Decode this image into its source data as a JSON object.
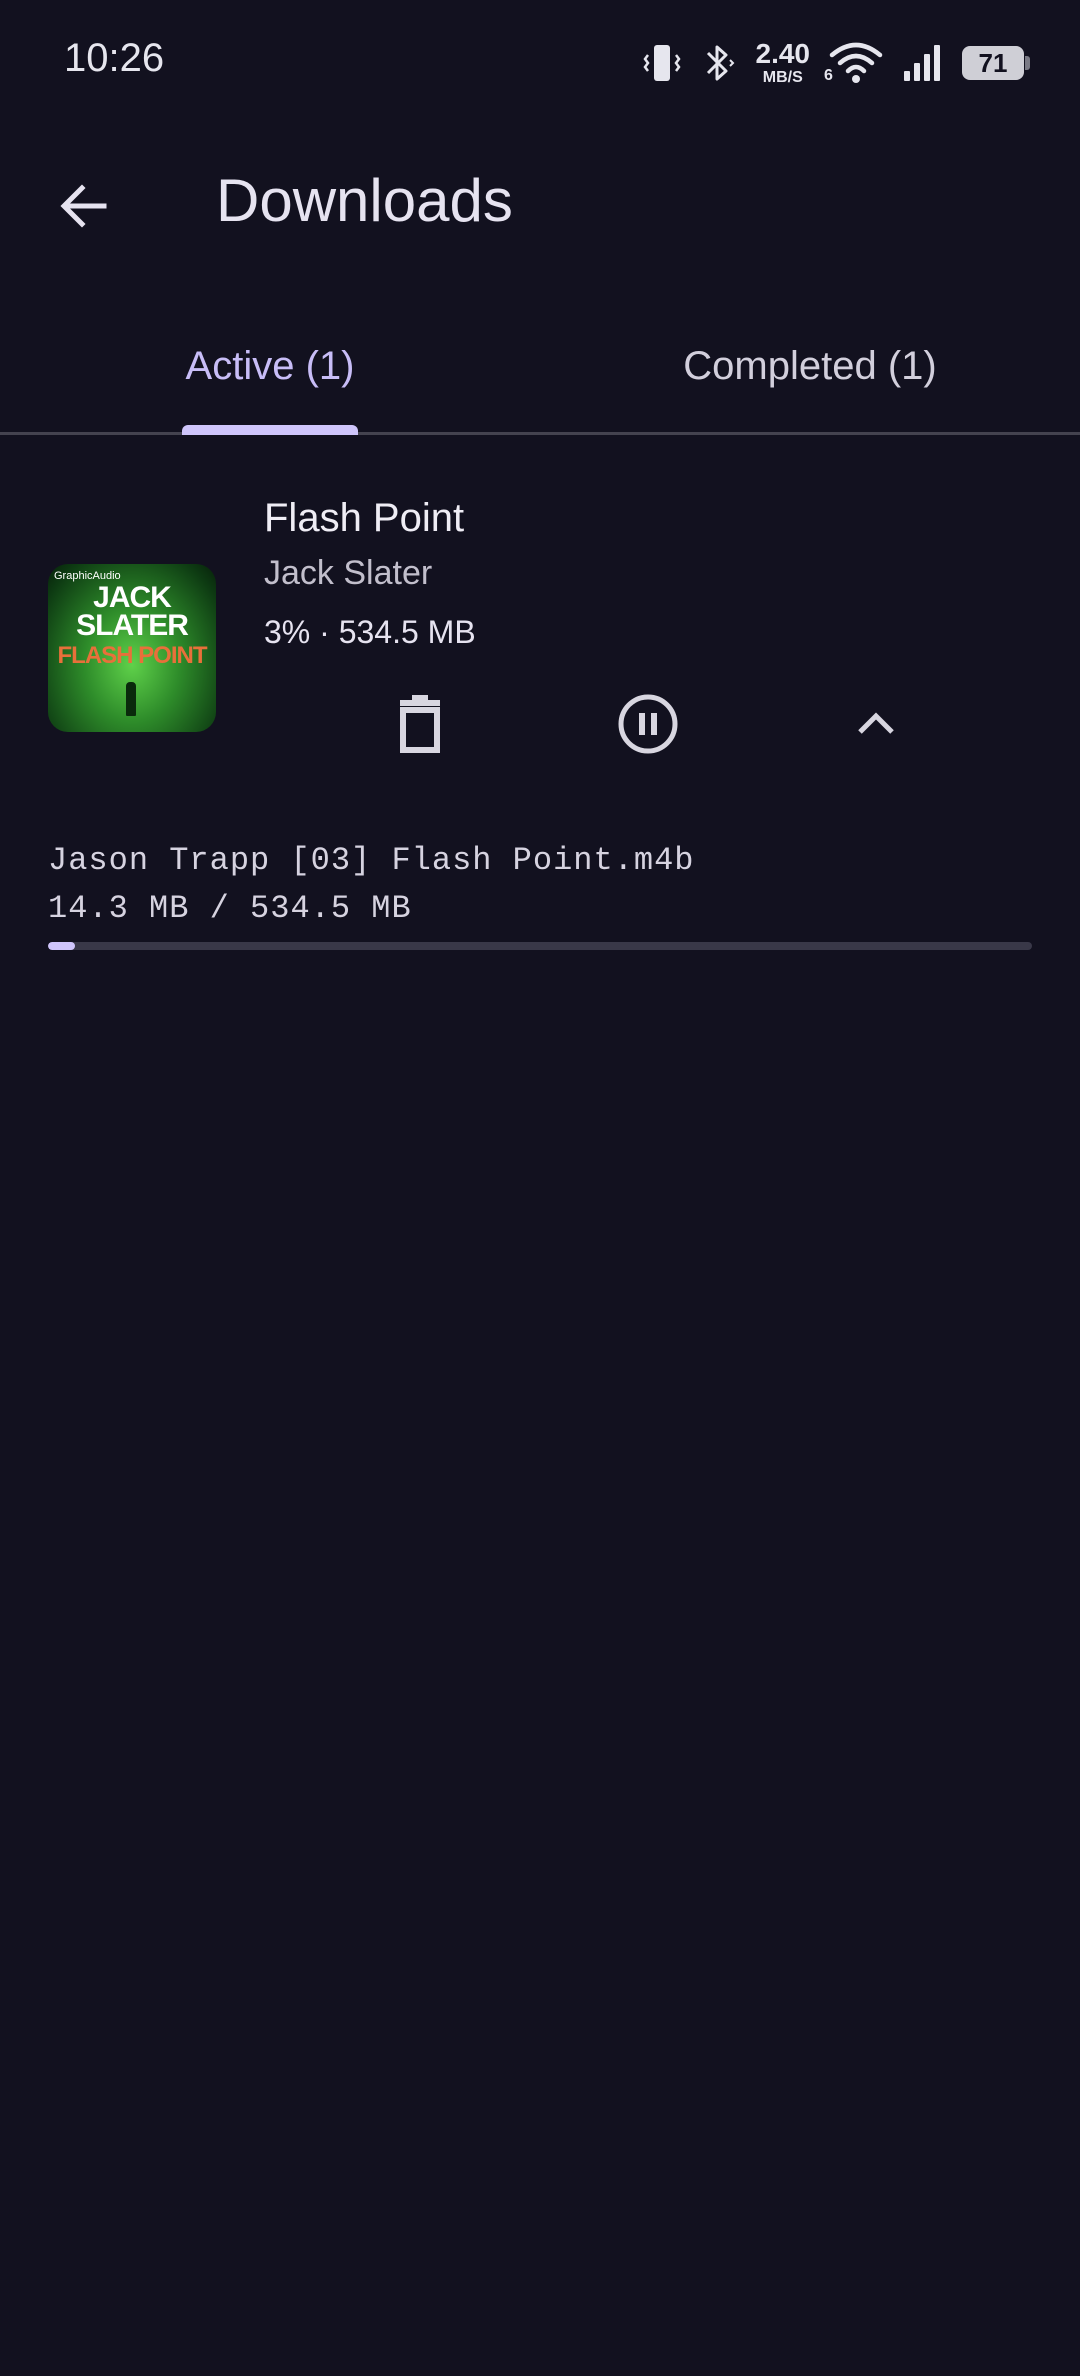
{
  "status_bar": {
    "time": "10:26",
    "net_speed_value": "2.40",
    "net_speed_unit": "MB/S",
    "wifi_generation": "6",
    "battery_level": "71"
  },
  "app_bar": {
    "title": "Downloads",
    "back_icon": "arrow-back-icon"
  },
  "tabs": [
    {
      "label": "Active (1)",
      "selected": true
    },
    {
      "label": "Completed (1)",
      "selected": false
    }
  ],
  "download": {
    "title": "Flash Point",
    "author": "Jack Slater",
    "progress_text": "3% · 534.5 MB",
    "cover_publisher": "GraphicAudio",
    "cover_author": "JACK SLATER",
    "cover_title": "FLASH POINT",
    "file_name": "Jason Trapp [03] Flash Point.m4b",
    "file_size_text": "14.3 MB / 534.5 MB",
    "progress_fraction": 0.027,
    "actions": {
      "delete_icon": "trash-icon",
      "pause_icon": "pause-circle-icon",
      "collapse_icon": "chevron-up-icon"
    }
  },
  "colors": {
    "background": "#12111f",
    "accent": "#cfc5fb",
    "active_tab_text": "#c8bdf7"
  }
}
